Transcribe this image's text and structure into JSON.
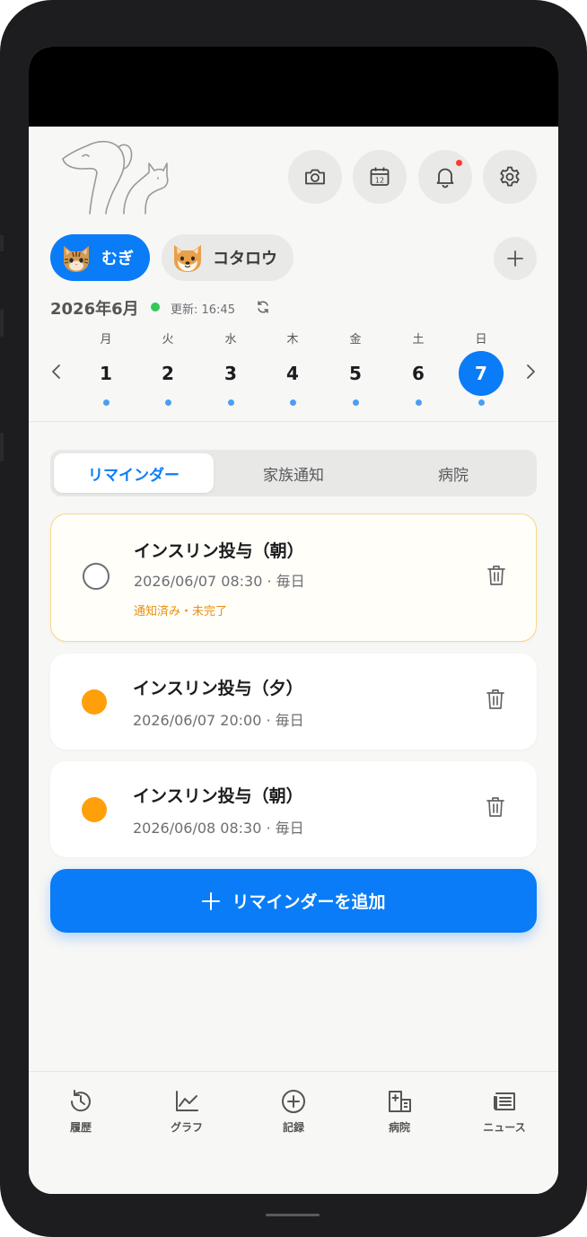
{
  "header": {
    "logo_icon": "dog-and-cat-line-logo",
    "actions": [
      {
        "name": "camera-button",
        "icon": "camera-icon"
      },
      {
        "name": "calendar-button",
        "icon": "calendar-icon",
        "icon_text": "12"
      },
      {
        "name": "notifications-button",
        "icon": "bell-icon",
        "has_badge": true
      },
      {
        "name": "settings-button",
        "icon": "gear-icon"
      }
    ]
  },
  "pets": [
    {
      "name": "むぎ",
      "icon": "tabby-cat-face-emoji",
      "selected": true
    },
    {
      "name": "コタロウ",
      "icon": "shiba-dog-face-emoji",
      "selected": false
    }
  ],
  "add_pet_icon": "plus-icon",
  "calendar": {
    "month_label": "2026年6月",
    "updated_label": "更新: 16:45",
    "status_color": "#34c759",
    "days": [
      {
        "dow": "月",
        "date": "1",
        "has_event": true
      },
      {
        "dow": "火",
        "date": "2",
        "has_event": true
      },
      {
        "dow": "水",
        "date": "3",
        "has_event": true
      },
      {
        "dow": "木",
        "date": "4",
        "has_event": true
      },
      {
        "dow": "金",
        "date": "5",
        "has_event": true
      },
      {
        "dow": "土",
        "date": "6",
        "has_event": true
      },
      {
        "dow": "日",
        "date": "7",
        "has_event": true,
        "selected": true
      }
    ]
  },
  "tabs": [
    {
      "label": "リマインダー",
      "active": true
    },
    {
      "label": "家族通知",
      "active": false
    },
    {
      "label": "病院",
      "active": false
    }
  ],
  "reminders": [
    {
      "title": "インスリン投与（朝）",
      "subtitle": "2026/06/07 08:30 · 毎日",
      "status": "通知済み・未完了",
      "done_state": "open"
    },
    {
      "title": "インスリン投与（夕）",
      "subtitle": "2026/06/07 20:00 · 毎日",
      "done_state": "pending"
    },
    {
      "title": "インスリン投与（朝）",
      "subtitle": "2026/06/08 08:30 · 毎日",
      "done_state": "pending"
    }
  ],
  "add_reminder_label": "リマインダーを追加",
  "bottom_nav": [
    {
      "label": "履歴",
      "icon": "history-icon"
    },
    {
      "label": "グラフ",
      "icon": "line-chart-icon"
    },
    {
      "label": "記録",
      "icon": "add-circle-icon"
    },
    {
      "label": "病院",
      "icon": "hospital-icon"
    },
    {
      "label": "ニュース",
      "icon": "newspaper-icon"
    }
  ],
  "colors": {
    "accent": "#0a7cf7",
    "pending": "#ff9f0a",
    "notified": "#e8900a",
    "badge": "#ff3b30"
  }
}
